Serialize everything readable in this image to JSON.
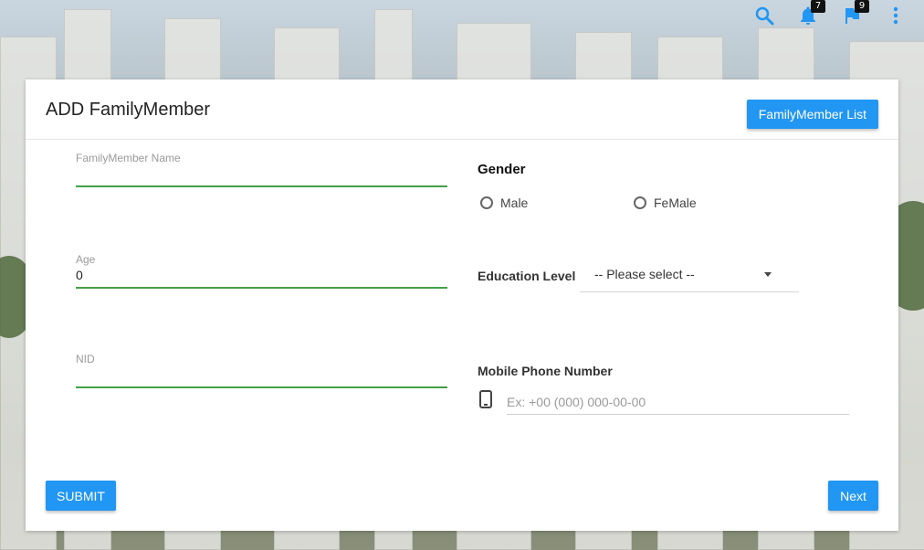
{
  "topbar": {
    "icons": [
      {
        "name": "search-icon"
      },
      {
        "name": "notifications-icon",
        "badge": "7"
      },
      {
        "name": "flag-icon",
        "badge": "9"
      },
      {
        "name": "more-vert-icon"
      }
    ],
    "accent": "#2196f3"
  },
  "card": {
    "title": "ADD FamilyMember",
    "list_button": "FamilyMember List"
  },
  "form": {
    "name": {
      "label": "FamilyMember Name",
      "value": ""
    },
    "age": {
      "label": "Age",
      "value": "0"
    },
    "nid": {
      "label": "NID",
      "value": ""
    },
    "gender": {
      "label": "Gender",
      "options": [
        "Male",
        "FeMale"
      ]
    },
    "education": {
      "label": "Education Level",
      "selected": "-- Please select --"
    },
    "phone": {
      "label": "Mobile Phone Number",
      "placeholder": "Ex: +00 (000) 000-00-00"
    }
  },
  "actions": {
    "submit": "SUBMIT",
    "next": "Next"
  },
  "colors": {
    "primary": "#2196f3",
    "underline_active": "#43a047"
  }
}
